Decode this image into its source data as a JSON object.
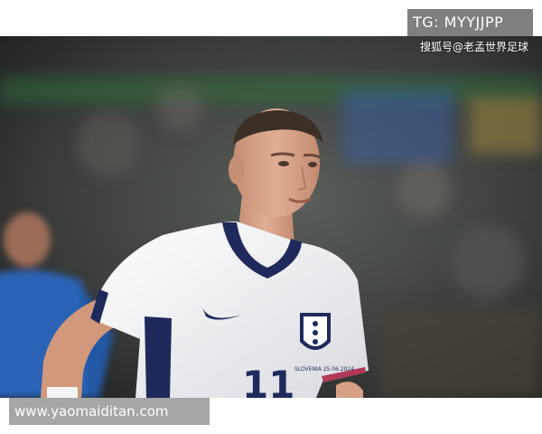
{
  "photo": {
    "subject": "footballer-in-white-england-kit",
    "shirt_number": "11",
    "crest_text": "SLOVENIA 25.06.2024",
    "colors": {
      "background_stadium": "#3a3d3c",
      "shirt": "#f2f2f4",
      "collar": "#1f2a5c",
      "skin": "#d9a48a",
      "hair": "#3b2f26",
      "opponent_blue": "#2a63b5"
    }
  },
  "overlays": {
    "tg_label": "TG: MYYJJPP",
    "cn_watermark": "搜狐号@老孟世界足球",
    "url_caption": "www.yaomaiditan.com"
  }
}
